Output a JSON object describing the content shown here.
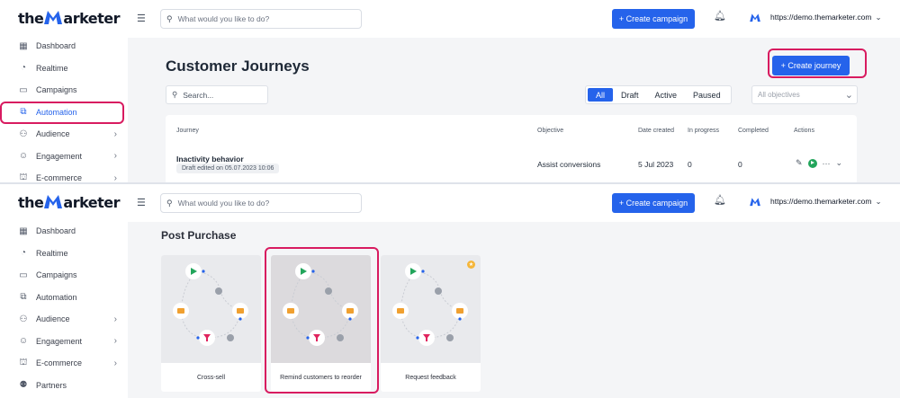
{
  "brand": {
    "name_pre": "the",
    "name_post": "arketer"
  },
  "sidebar_top": [
    {
      "label": "Dashboard",
      "icon": "dashboard-icon",
      "glyph": "▦"
    },
    {
      "label": "Realtime",
      "icon": "realtime-icon",
      "glyph": "◔"
    },
    {
      "label": "Campaigns",
      "icon": "campaigns-icon",
      "glyph": "▭"
    },
    {
      "label": "Automation",
      "icon": "automation-icon",
      "glyph": "⧉",
      "active": true
    },
    {
      "label": "Audience",
      "icon": "audience-icon",
      "glyph": "⚇",
      "chevron": true
    },
    {
      "label": "Engagement",
      "icon": "engagement-icon",
      "glyph": "☺",
      "chevron": true
    },
    {
      "label": "E-commerce",
      "icon": "ecommerce-icon",
      "glyph": "⛫",
      "chevron": true
    }
  ],
  "sidebar_bottom": [
    {
      "label": "Dashboard",
      "icon": "dashboard-icon",
      "glyph": "▦"
    },
    {
      "label": "Realtime",
      "icon": "realtime-icon",
      "glyph": "◔"
    },
    {
      "label": "Campaigns",
      "icon": "campaigns-icon",
      "glyph": "▭"
    },
    {
      "label": "Automation",
      "icon": "automation-icon",
      "glyph": "⧉"
    },
    {
      "label": "Audience",
      "icon": "audience-icon",
      "glyph": "⚇",
      "chevron": true
    },
    {
      "label": "Engagement",
      "icon": "engagement-icon",
      "glyph": "☺",
      "chevron": true
    },
    {
      "label": "E-commerce",
      "icon": "ecommerce-icon",
      "glyph": "⛫",
      "chevron": true
    },
    {
      "label": "Partners",
      "icon": "partners-icon",
      "glyph": "⚉"
    }
  ],
  "topbar": {
    "search_placeholder": "What would you like to do?",
    "create_campaign": "+ Create campaign",
    "domain": "https://demo.themarketer.com"
  },
  "journeys": {
    "title": "Customer Journeys",
    "create_journey": "+ Create journey",
    "search_placeholder": "Search...",
    "filters": [
      "All",
      "Draft",
      "Active",
      "Paused"
    ],
    "selected_filter": "All",
    "objectives_placeholder": "All objectives",
    "columns": {
      "journey": "Journey",
      "objective": "Objective",
      "date_created": "Date created",
      "in_progress": "In progress",
      "completed": "Completed",
      "actions": "Actions"
    },
    "rows": [
      {
        "name": "Inactivity behavior",
        "status": "Draft edited on 05.07.2023 10:06",
        "objective": "Assist conversions",
        "date_created": "5 Jul 2023",
        "in_progress": "0",
        "completed": "0"
      }
    ]
  },
  "templates": {
    "section_title": "Post Purchase",
    "cards": [
      {
        "label": "Cross-sell",
        "highlighted": false,
        "starred": false
      },
      {
        "label": "Remind customers to reorder",
        "highlighted": true,
        "starred": false
      },
      {
        "label": "Request feedback",
        "highlighted": false,
        "starred": true
      }
    ]
  },
  "colors": {
    "accent": "#2563eb",
    "highlight": "#d81b60",
    "success": "#22a55b",
    "email_node": "#f0a030",
    "filter_node": "#e0245e"
  }
}
